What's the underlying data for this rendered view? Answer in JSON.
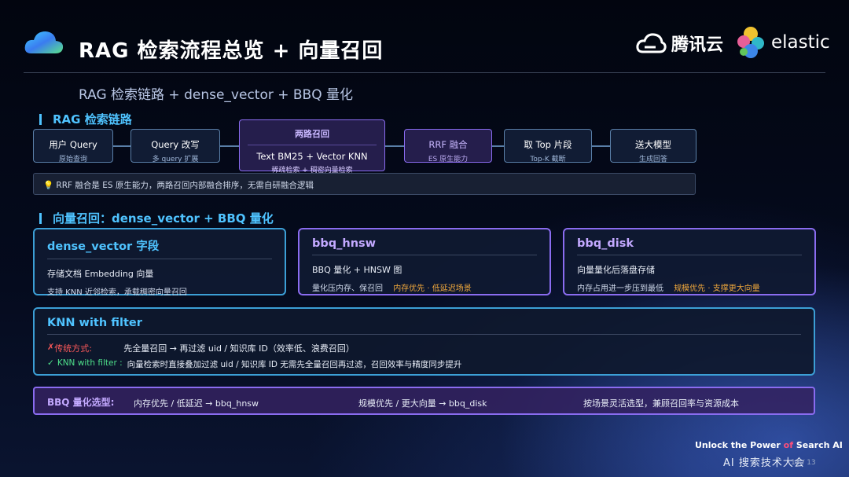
{
  "header": {
    "title": "RAG 检索流程总览 + 向量召回",
    "tencent_logo_text": "腾讯云",
    "elastic_logo_text": "elastic",
    "subtitle": "RAG 检索链路 + dense_vector + BBQ 量化"
  },
  "section_rag": {
    "title": "RAG 检索链路",
    "steps": [
      {
        "title": "用户 Query",
        "sub": "原始查询"
      },
      {
        "title": "Query 改写",
        "sub": "多 query 扩展"
      },
      {
        "heading": "两路召回",
        "title": "Text BM25 + Vector KNN",
        "sub": "稀疏检索 + 稠密向量检索"
      },
      {
        "title": "RRF 融合",
        "sub": "ES 原生能力"
      },
      {
        "title": "取 Top 片段",
        "sub": "Top-K 截断"
      },
      {
        "title": "送大模型",
        "sub": "生成回答"
      }
    ],
    "note": "RRF 融合是 ES 原生能力，两路召回内部融合排序，无需自研融合逻辑"
  },
  "section_vector": {
    "title": "向量召回：dense_vector + BBQ 量化",
    "cards": [
      {
        "title": "dense_vector 字段",
        "line1": "存储文档 Embedding 向量",
        "line2": "支持 KNN 近邻检索，承载稠密向量召回",
        "line2_highlight": ""
      },
      {
        "title": "bbq_hnsw",
        "line1": "BBQ 量化 + HNSW 图",
        "line2": "量化压内存、保召回",
        "line2_highlight": "内存优先 · 低延迟场景"
      },
      {
        "title": "bbq_disk",
        "line1": "向量量化后落盘存储",
        "line2": "内存占用进一步压到最低",
        "line2_highlight": "规模优先 · 支撑更大向量"
      }
    ]
  },
  "knn_filter": {
    "title": "KNN with filter",
    "traditional_label": "传统方式:",
    "traditional_text": "先全量召回 → 再过滤 uid / 知识库 ID（效率低、浪费召回）",
    "knn_label": "KNN with filter :",
    "knn_text": "向量检索时直接叠加过滤 uid / 知识库 ID 无需先全量召回再过滤，召回效率与精度同步提升"
  },
  "bbq_selection": {
    "label": "BBQ 量化选型:",
    "option1": "内存优先 / 低延迟 → bbq_hnsw",
    "option2": "规模优先 / 更大向量 → bbq_disk",
    "option3": "按场景灵活选型，兼顾召回率与资源成本"
  },
  "footer": {
    "tagline_pre": "Unlock the Power",
    "tagline_of": "of",
    "tagline_post": "Search AI",
    "conference": "AI 搜索技术大会",
    "page": "13 / 13"
  },
  "colors": {
    "accent_blue": "#4fc3ff",
    "accent_purple": "#8a6cf0",
    "highlight_orange": "#f0a83c",
    "error_red": "#ff5a5a",
    "success_green": "#4ee08a"
  },
  "icons": [
    "tencent-cloud-logo-icon",
    "elastic-logo-icon",
    "cloud-logo-icon",
    "lightbulb-icon",
    "cross-icon",
    "check-icon"
  ]
}
